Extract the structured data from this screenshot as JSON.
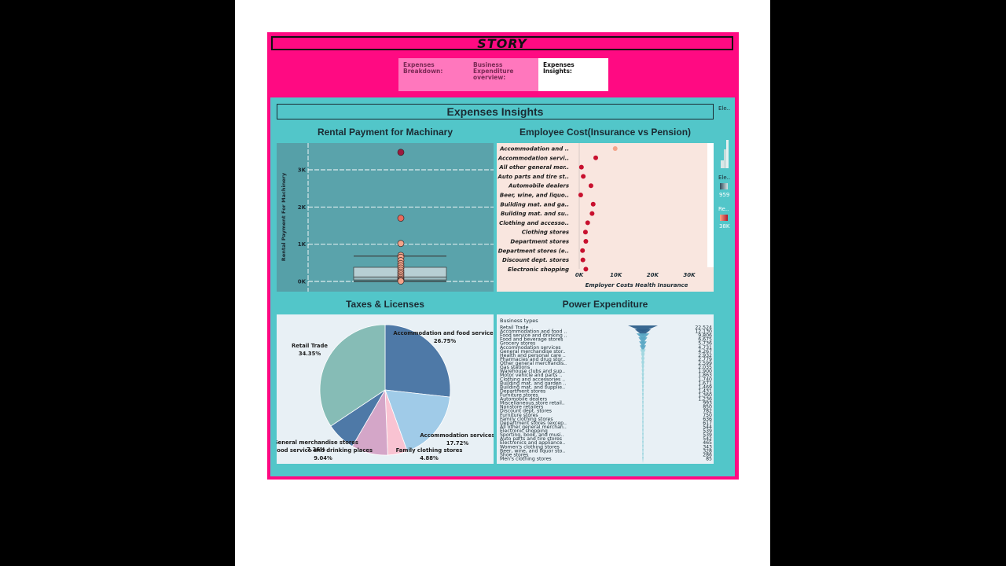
{
  "story": {
    "title": "STORY"
  },
  "tabs": [
    {
      "label": "Expenses Breakdown:"
    },
    {
      "label": "Business Expenditure overview:"
    },
    {
      "label": "Expenses Insights:"
    }
  ],
  "dashboard": {
    "title": "Expenses Insights"
  },
  "legend": {
    "ele1": "Ele..",
    "ele2": "Ele..",
    "re": "Re..",
    "ele2_value": "959",
    "re_value": "38K"
  },
  "colors": {
    "story_bg": "#ff0a82",
    "dash_bg": "#52c6c9",
    "box_panel": "#5aa3ab",
    "dot_panel": "#f9e6df",
    "pie_panel": "#e8f0f5"
  },
  "rental": {
    "title": "Rental Payment for Machinary",
    "chart_data": {
      "type": "scatter",
      "ylabel": "Rental Payment For Machinery",
      "ylim": [
        0,
        3500
      ],
      "yticks": [
        "0K",
        "1K",
        "2K",
        "3K"
      ],
      "ytick_values": [
        0,
        1000,
        2000,
        3000
      ],
      "points": [
        3470,
        1700,
        1020,
        700,
        650,
        560,
        480,
        420,
        360,
        300,
        250,
        200,
        150,
        100,
        60,
        30,
        10
      ],
      "box": {
        "q1": 40,
        "median": 120,
        "q3": 380,
        "whisker_high": 680,
        "whisker_low": 0
      }
    }
  },
  "employee": {
    "title": "Employee Cost(Insurance vs Pension)",
    "chart_data": {
      "type": "scatter",
      "xlabel": "Employer Costs Health Insurance",
      "xlim": [
        0,
        33000
      ],
      "xticks": [
        "0K",
        "10K",
        "20K",
        "30K"
      ],
      "xtick_values": [
        0,
        10000,
        20000,
        30000
      ],
      "categories": [
        "Accommodation and ..",
        "Accommodation servi..",
        "All other general mer..",
        "Auto parts and tire st..",
        "Automobile dealers",
        "Beer, wine, and liquo..",
        "Building mat. and ga..",
        "Building mat. and su..",
        "Clothing and accesso..",
        "Clothing stores",
        "Department stores",
        "Department stores (e..",
        "Discount dept. stores",
        "Electronic shopping"
      ],
      "values": [
        9800,
        4500,
        600,
        1100,
        3200,
        400,
        3800,
        3500,
        2300,
        1700,
        1800,
        900,
        1000,
        1800
      ]
    }
  },
  "taxes": {
    "title": "Taxes & Licenses",
    "chart_data": {
      "type": "pie",
      "slices": [
        {
          "name": "Accommodation and food services",
          "pct_label": "26.75%",
          "value": 26.75,
          "color": "#4e79a7"
        },
        {
          "name": "Accommodation services",
          "pct_label": "17.72%",
          "value": 17.72,
          "color": "#a0cbe8"
        },
        {
          "name": "Family clothing stores",
          "pct_label": "4.88%",
          "value": 4.88,
          "color": "#f9c3d2"
        },
        {
          "name": "Food service and drinking places",
          "pct_label": "9.04%",
          "value": 9.04,
          "color": "#d4a6c8"
        },
        {
          "name": "General merchandise stores",
          "pct_label": "7.26%",
          "value": 7.26,
          "color": "#4e79a7"
        },
        {
          "name": "Retail Trade",
          "pct_label": "34.35%",
          "value": 34.35,
          "color": "#86bcb6"
        }
      ]
    }
  },
  "power": {
    "title": "Power Expenditure",
    "chart_data": {
      "type": "bar",
      "header": "Business types",
      "categories": [
        "Retail Trade",
        "Accommodation and food ..",
        "Food service and drinking ..",
        "Food and beverage stores",
        "Grocery stores",
        "Accommodation services",
        "General merchandise stor..",
        "Health and personal care ..",
        "Pharmacies and drug stor..",
        "Other general merchandis..",
        "Gas stations",
        "Warehouse clubs and sup..",
        "Motor vehicle and parts ..",
        "Clothing and accessories ..",
        "Building mat. and garden ..",
        "Building mat. and supplie..",
        "Department stores",
        "Furniture stores",
        "Automobile dealers",
        "Miscellaneous store retail..",
        "Nonstore retailers",
        "Discount dept. stores",
        "Furniture stores",
        "Family clothing stores",
        "Department stores (excep..",
        "All other general merchan..",
        "Electronic shopping",
        "Sporting, book, and musi..",
        "Auto parts and tire stores",
        "Electronics and appliance..",
        "Women's clothing stores",
        "Beer, wine, and liquor sto..",
        "Shoe stores",
        "Men's clothing stores"
      ],
      "values": [
        22524,
        12130,
        9806,
        6675,
        5736,
        4731,
        4267,
        2932,
        2779,
        2599,
        2035,
        1900,
        1863,
        1740,
        1671,
        1469,
        1431,
        1360,
        1236,
        993,
        850,
        782,
        750,
        636,
        617,
        544,
        539,
        539,
        542,
        465,
        343,
        328,
        286,
        85
      ],
      "labels": [
        "22,524",
        "12,130",
        "9,806",
        "6,675",
        "5,736",
        "4,731",
        "4,267",
        "2,932",
        "2,779",
        "2,599",
        "2,035",
        "1,900",
        "1,863",
        "1,740",
        "1,671",
        "1,469",
        "1,431",
        "1,360",
        "1,236",
        "993",
        "850",
        "782",
        "750",
        "636",
        "617",
        "544",
        "539",
        "539",
        "542",
        "465",
        "343",
        "328",
        "286",
        "85"
      ]
    }
  }
}
